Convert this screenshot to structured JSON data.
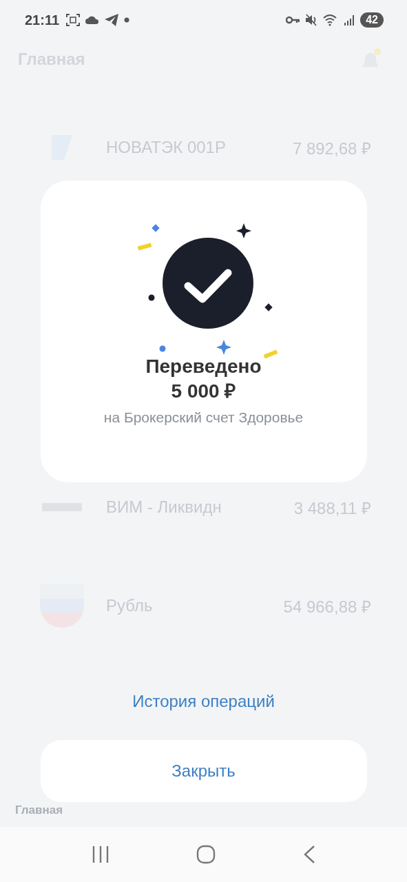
{
  "status_bar": {
    "time": "21:11",
    "battery": "42"
  },
  "background": {
    "title": "Главная",
    "assets": [
      {
        "kind": "bond",
        "name": "НОВАТЭК 001Р",
        "value": "7 892,68 ₽"
      },
      {
        "kind": "fund",
        "name": "ВИМ - Ликвидн",
        "value": "3 488,11 ₽"
      },
      {
        "kind": "currency",
        "name": "Рубль",
        "value": "54 966,88 ₽"
      }
    ],
    "tab_label": "Главная"
  },
  "dialog": {
    "title": "Переведено",
    "amount": "5 000 ₽",
    "description": "на Брокерский счет Здоровье",
    "history_link": "История операций",
    "close_button": "Закрыть"
  }
}
